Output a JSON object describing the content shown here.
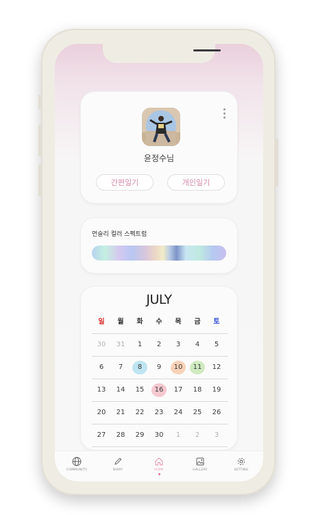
{
  "profile": {
    "name": "윤정수님",
    "quick_diary": "간편일기",
    "personal_diary": "개인일기"
  },
  "spectrum": {
    "title": "먼슬리 컬러 스펙트럼"
  },
  "calendar": {
    "month": "JULY",
    "weekdays": [
      "일",
      "월",
      "화",
      "수",
      "목",
      "금",
      "토"
    ],
    "weekday_colors": [
      "#e02a2a",
      "#333333",
      "#333333",
      "#333333",
      "#333333",
      "#333333",
      "#2a46d6"
    ],
    "weeks": [
      [
        "30",
        "31",
        "1",
        "2",
        "3",
        "4",
        "5"
      ],
      [
        "6",
        "7",
        "8",
        "9",
        "10",
        "11",
        "12"
      ],
      [
        "13",
        "14",
        "15",
        "16",
        "17",
        "18",
        "19"
      ],
      [
        "20",
        "21",
        "22",
        "23",
        "24",
        "25",
        "26"
      ],
      [
        "27",
        "28",
        "29",
        "30",
        "1",
        "2",
        "3"
      ]
    ],
    "highlights": {
      "8": "#bfe5f2",
      "10": "#f7d2b8",
      "11": "#cfeac0",
      "16": "#f5c8d0"
    }
  },
  "tabbar": {
    "items": [
      {
        "label": "COMMUNITY",
        "icon": "globe-icon"
      },
      {
        "label": "DIARY",
        "icon": "pencil-icon"
      },
      {
        "label": "HOME",
        "icon": "home-icon"
      },
      {
        "label": "GALLERY",
        "icon": "image-icon"
      },
      {
        "label": "SETTING",
        "icon": "gear-icon"
      }
    ],
    "active": "HOME"
  }
}
